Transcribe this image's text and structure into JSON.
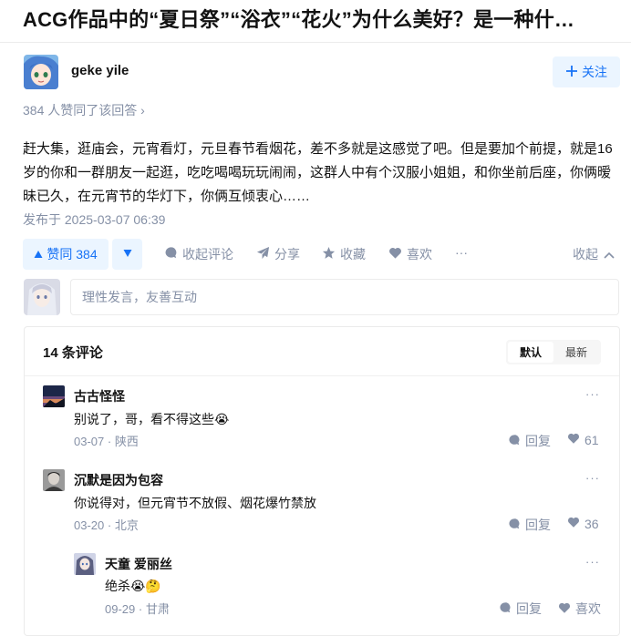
{
  "question": {
    "title": "ACG作品中的“夏日祭”“浴衣”“花火”为什么美好？是一种什…"
  },
  "author": {
    "name": "geke yile",
    "follow_label": "关注"
  },
  "voters_text": "384 人赞同了该回答 ›",
  "answer": {
    "content": "赶大集，逛庙会，元宵看灯，元旦春节看烟花，差不多就是这感觉了吧。但是要加个前提，就是16岁的你和一群朋友一起逛，吃吃喝喝玩玩闹闹，这群人中有个汉服小姐姐，和你坐前后座，你俩暧昧已久，在元宵节的华灯下，你俩互倾衷心……",
    "published": "发布于 2025-03-07 06:39"
  },
  "actions": {
    "upvote_label": "赞同 384",
    "collapse_comments": "收起评论",
    "share": "分享",
    "favorite": "收藏",
    "like": "喜欢",
    "more": "···",
    "collapse": "收起"
  },
  "comment_input": {
    "placeholder": "理性发言，友善互动"
  },
  "comments_panel": {
    "count_label": "14 条评论",
    "sort_default": "默认",
    "sort_latest": "最新"
  },
  "comments": [
    {
      "name": "古古怪怪",
      "text": "别说了，哥，看不得这些😭",
      "date": "03-07",
      "location": "陕西",
      "reply": "回复",
      "likes": "61"
    },
    {
      "name": "沉默是因为包容",
      "text": "你说得对，但元宵节不放假、烟花爆竹禁放",
      "date": "03-20",
      "location": "北京",
      "reply": "回复",
      "likes": "36"
    },
    {
      "name": "天童 爱丽丝",
      "text": "绝杀😭🤔",
      "date": "09-29",
      "location": "甘肃",
      "reply": "回复",
      "likes": "喜欢"
    }
  ],
  "colors": {
    "brand": "#1772f6",
    "brand_bg": "#ebf5ff",
    "meta": "#8590a6"
  }
}
